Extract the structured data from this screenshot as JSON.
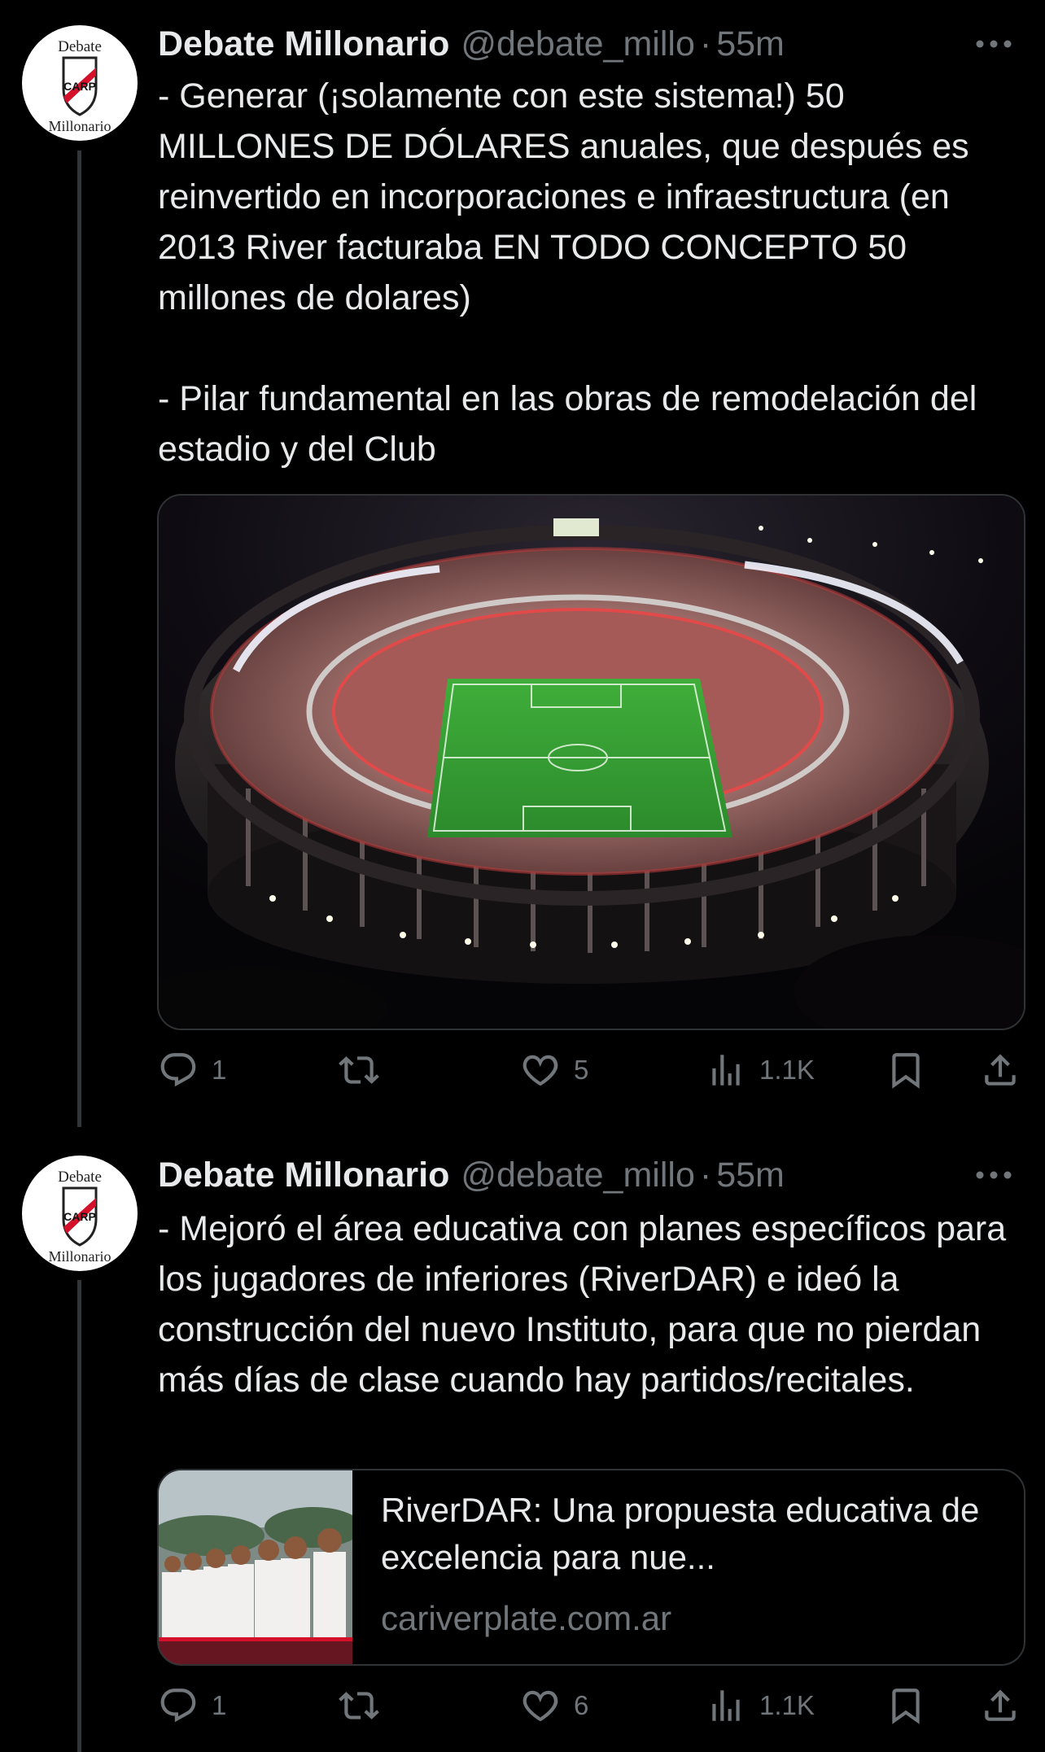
{
  "tweets": [
    {
      "author": {
        "name": "Debate Millonario",
        "handle": "@debate_millo",
        "avatar_top_text": "Debate",
        "avatar_bottom_text": "Millonario",
        "avatar_crest": "CARP"
      },
      "dot": "·",
      "timestamp": "55m",
      "text": "- Generar (¡solamente con este sistema!) 50 MILLONES DE DÓLARES anuales, que después es reinvertido en incorporaciones e infraestructura (en 2013 River facturaba EN TODO CONCEPTO 50 millones de dolares)\n\n- Pilar fundamental en las obras de remodelación del estadio y del Club",
      "media": {
        "kind": "image",
        "subject": "stadium-at-night"
      },
      "actions": {
        "replies": "1",
        "retweets": "",
        "likes": "5",
        "views": "1.1K"
      }
    },
    {
      "author": {
        "name": "Debate Millonario",
        "handle": "@debate_millo",
        "avatar_top_text": "Debate",
        "avatar_bottom_text": "Millonario",
        "avatar_crest": "CARP"
      },
      "dot": "·",
      "timestamp": "55m",
      "text": "- Mejoró el área educativa con planes específicos para los jugadores de inferiores (RiverDAR) e ideó la construcción del nuevo Instituto, para que no pierdan más días de clase cuando hay partidos/recitales.",
      "link_card": {
        "title": "RiverDAR: Una propuesta educativa de excelencia para nue...",
        "domain": "cariverplate.com.ar"
      },
      "actions": {
        "replies": "1",
        "retweets": "",
        "likes": "6",
        "views": "1.1K"
      }
    }
  ],
  "icons": {
    "more": "more-horizontal-icon",
    "reply": "reply-icon",
    "retweet": "retweet-icon",
    "like": "heart-icon",
    "views": "views-chart-icon",
    "bookmark": "bookmark-icon",
    "share": "share-icon"
  },
  "colors": {
    "background": "#000000",
    "text_primary": "#e7e9ea",
    "text_secondary": "#71767b",
    "border": "#2f3336",
    "river_red": "#d4102a"
  }
}
